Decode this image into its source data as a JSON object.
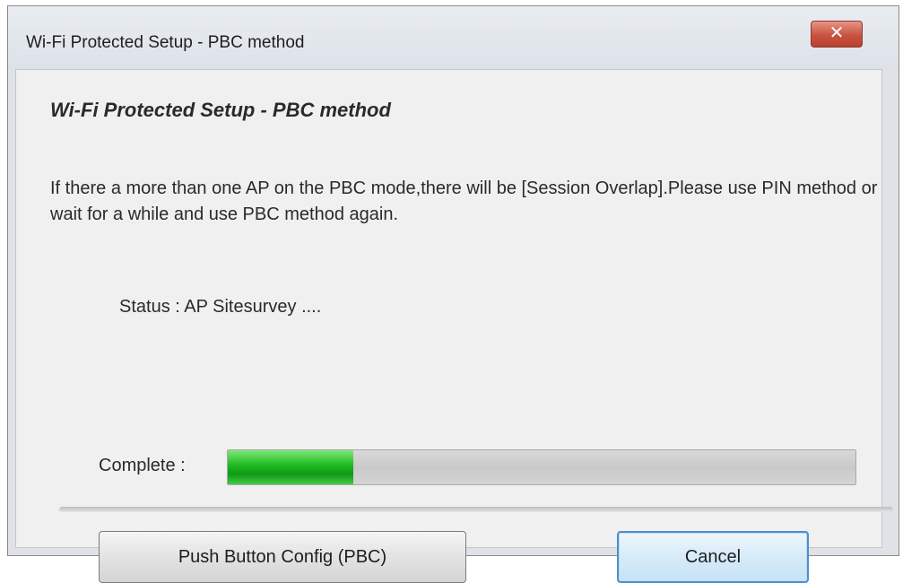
{
  "window": {
    "title": "Wi-Fi Protected Setup - PBC method",
    "close_icon": "✕"
  },
  "content": {
    "heading": "Wi-Fi Protected Setup - PBC method",
    "description": "If there a more than one AP on the PBC mode,there will be [Session Overlap].Please use PIN method or wait for a while and use PBC method again.",
    "status_text": "Status : AP Sitesurvey ....",
    "complete_label": "Complete :",
    "progress_fraction": 0.2
  },
  "buttons": {
    "pbc_label": "Push Button Config (PBC)",
    "cancel_label": "Cancel"
  },
  "colors": {
    "progress_green": "#1db81f",
    "close_red": "#c8533f",
    "focus_blue": "#4e8fc9"
  }
}
